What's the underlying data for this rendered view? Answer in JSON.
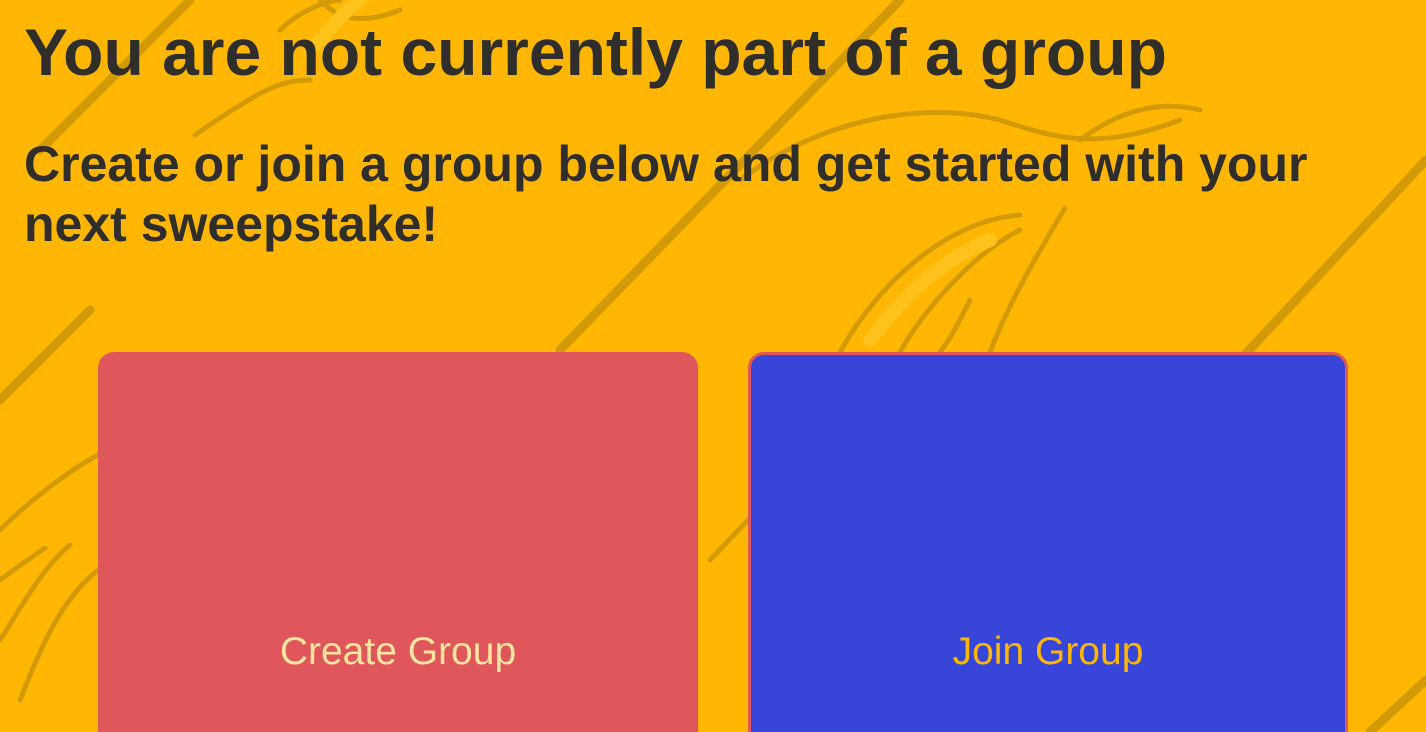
{
  "header": {
    "title": "You are not currently part of a group",
    "subtitle": "Create or join a group below and get started with your next sweepstake!"
  },
  "actions": {
    "create": {
      "label": "Create Group",
      "color": "#E0575B",
      "text_color": "#FFE3A0"
    },
    "join": {
      "label": "Join Group",
      "color": "#3745D8",
      "text_color": "#FFB703"
    }
  },
  "theme": {
    "background": "#FFB703",
    "pattern_stroke": "#D39A08",
    "text": "#2F2E2B"
  }
}
